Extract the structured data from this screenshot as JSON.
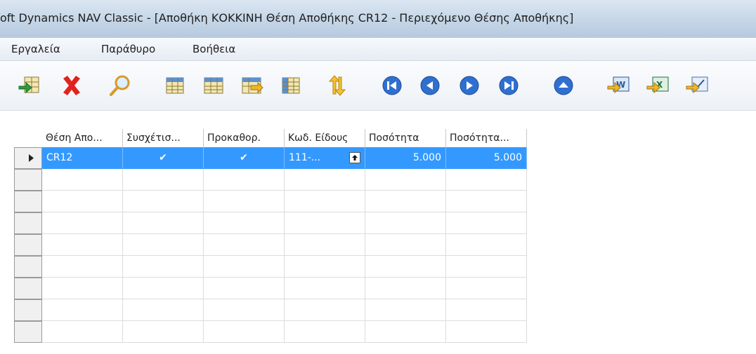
{
  "window": {
    "title": "oft Dynamics NAV Classic - [Αποθήκη ΚΟΚΚΙΝΗ Θέση Αποθήκης CR12 - Περιεχόμενο Θέσης Αποθήκης]"
  },
  "menu": {
    "items": [
      {
        "label": "Εργαλεία"
      },
      {
        "label": "Παράθυρο"
      },
      {
        "label": "Βοήθεια"
      }
    ]
  },
  "toolbar": {
    "icons": [
      "new-record-icon",
      "delete-icon",
      "find-icon",
      "table-view-icon",
      "table-view-alt-icon",
      "table-export-icon",
      "grid-icon",
      "sort-icon",
      "first-record-icon",
      "previous-record-icon",
      "next-record-icon",
      "last-record-icon",
      "up-icon",
      "send-to-word-icon",
      "send-to-excel-icon",
      "send-to-checklist-icon"
    ]
  },
  "grid": {
    "columns": [
      {
        "label": "Θέση Απο..."
      },
      {
        "label": "Συσχέτισ..."
      },
      {
        "label": "Προκαθορ."
      },
      {
        "label": "Κωδ. Είδους"
      },
      {
        "label": "Ποσότητα"
      },
      {
        "label": "Ποσότητα..."
      }
    ],
    "rows": [
      {
        "bin_code": "CR12",
        "linked": "✔",
        "default": "✔",
        "item_no": "111-...",
        "quantity": "5.000",
        "quantity_base": "5.000"
      }
    ],
    "empty_rows": 8
  },
  "colors": {
    "selection": "#3399ff",
    "titlebar": "#c3d4e6"
  }
}
